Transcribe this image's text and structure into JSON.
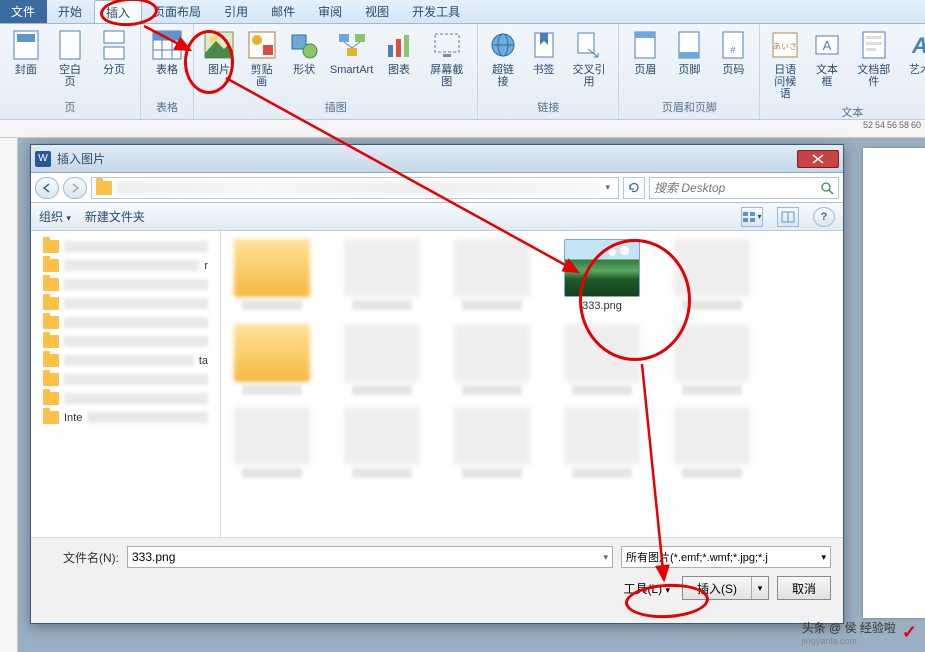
{
  "ribbon_tabs": {
    "file": "文件",
    "home": "开始",
    "insert": "插入",
    "layout": "页面布局",
    "references": "引用",
    "mailings": "邮件",
    "review": "审阅",
    "view": "视图",
    "developer": "开发工具"
  },
  "groups": {
    "pages": {
      "label": "页",
      "cover": "封面",
      "blank": "空白页",
      "break": "分页"
    },
    "tables": {
      "label": "表格",
      "table": "表格"
    },
    "illustrations": {
      "label": "插图",
      "picture": "图片",
      "clipart": "剪贴画",
      "shapes": "形状",
      "smartart": "SmartArt",
      "chart": "图表",
      "screenshot": "屏幕截图"
    },
    "links": {
      "label": "链接",
      "hyperlink": "超链接",
      "bookmark": "书签",
      "crossref": "交叉引用"
    },
    "header_footer": {
      "label": "页眉和页脚",
      "header": "页眉",
      "footer": "页脚",
      "pagenum": "页码"
    },
    "text": {
      "label": "文本",
      "greeting": "日语\n问候语",
      "textbox": "文本框",
      "quickparts": "文档部件",
      "wordart": "艺术"
    }
  },
  "ruler_ticks": [
    "52",
    "54",
    "56",
    "58",
    "60"
  ],
  "dialog": {
    "title": "插入图片",
    "organize": "组织",
    "new_folder": "新建文件夹",
    "search_placeholder": "搜索 Desktop",
    "selected_file": "333.png",
    "filename_label": "文件名(N):",
    "filename_value": "333.png",
    "filter": "所有图片(*.emf;*.wmf;*.jpg;*.j",
    "tools": "工具(L)",
    "insert": "插入(S)",
    "cancel": "取消"
  },
  "tree_items": [
    "",
    "r",
    "",
    "",
    "",
    "",
    "ta",
    "",
    "",
    "Inte"
  ],
  "watermark": {
    "main": "头条 @ 侯 经验啦",
    "sub": "jingyanla.com"
  }
}
